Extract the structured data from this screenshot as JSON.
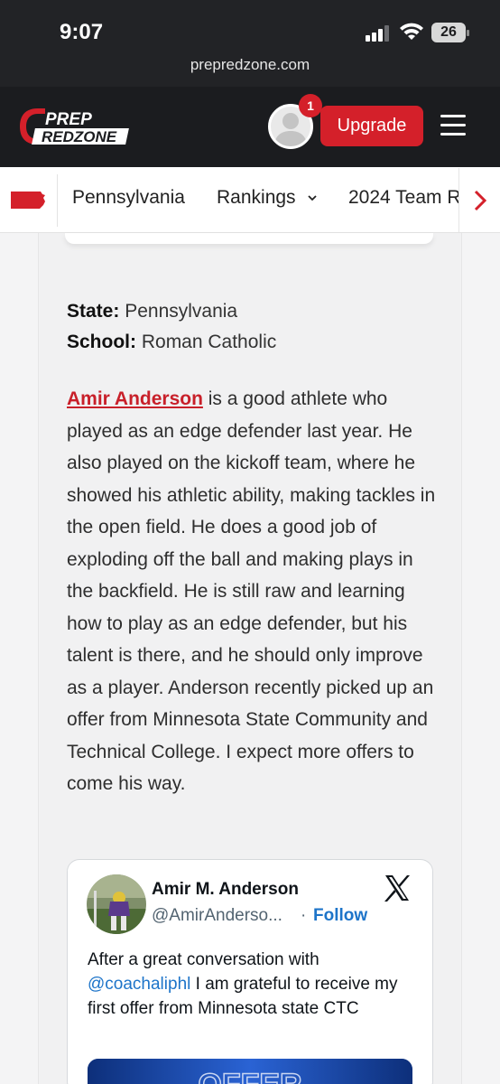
{
  "status_bar": {
    "time": "9:07",
    "battery": "26",
    "url": "prepredzone.com"
  },
  "header": {
    "logo_line1": "PREP",
    "logo_line2": "REDZONE",
    "notification_count": "1",
    "upgrade_label": "Upgrade",
    "brand_color": "#d4202a"
  },
  "nav": {
    "items": [
      "Pennsylvania",
      "Rankings",
      "2024 Team R"
    ],
    "rankings_chevron": "chevron-down-icon",
    "scroll_right_icon": "chevron-right-icon"
  },
  "article": {
    "state_label": "State:",
    "state_value": "Pennsylvania",
    "school_label": "School:",
    "school_value": "Roman Catholic",
    "player_link": "Amir Anderson",
    "body": " is a good athlete who played as an edge defender last year. He also played on the kickoff team, where he showed his athletic ability, making tackles in the open field. He does a good job of exploding off the ball and making plays in the backfield. He is still raw and learning how to play as an edge defender, but his talent is there, and he should only improve as a player. Anderson recently picked up an offer from Minnesota State Community and Technical College. I expect more offers to come his way."
  },
  "tweet": {
    "name": "Amir M. Anderson",
    "handle": "@AmirAnderso...",
    "separator": "·",
    "follow_label": "Follow",
    "text_before": "After a great conversation with ",
    "mention": "@coachaliphl",
    "text_after": " I am grateful to receive my first offer from Minnesota state CTC",
    "media_text": "OFFER"
  }
}
